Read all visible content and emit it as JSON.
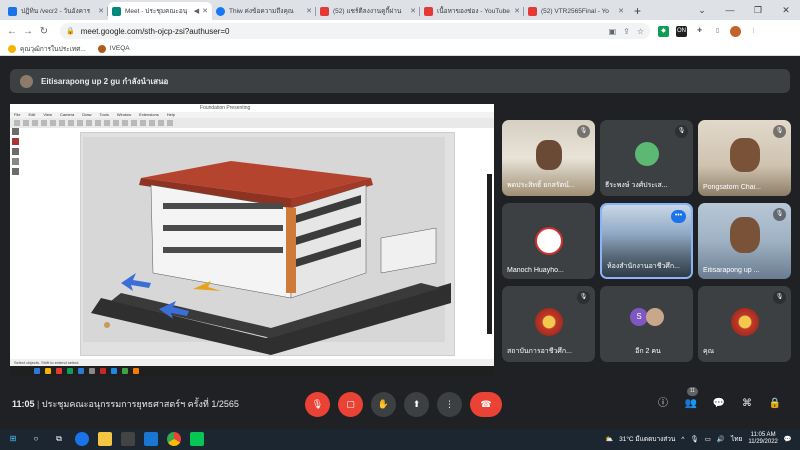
{
  "browser": {
    "tabs": [
      {
        "label": "ปฏิทิน /vecr2 - วันอังคาร",
        "color": "#1a73e8",
        "active": false
      },
      {
        "label": "Meet - ประชุมคณะอนุ",
        "color": "#00897b",
        "active": true
      },
      {
        "label": "Thiw ค่งข้อความถึงคุณ",
        "color": "#1877f2",
        "active": false
      },
      {
        "label": "(52) แชร์ตีลงงานคูกี้ผ่าน",
        "color": "#e53935",
        "active": false
      },
      {
        "label": "เนื้อหาของช่อง - YouTube",
        "color": "#e53935",
        "active": false
      },
      {
        "label": "(52) VTR2565Final - Yo",
        "color": "#e53935",
        "active": false
      }
    ],
    "new_tab": "+",
    "url": "meet.google.com/sth-ojcp-zsi?authuser=0",
    "bookmarks": [
      {
        "label": "คุณวุฒิการในประเทศ...",
        "color": "#f4b400"
      },
      {
        "label": "IVEQA",
        "color": "#b05a1e"
      }
    ]
  },
  "meet": {
    "presenter_label": "Eitisarapong up 2 gu กำลังนำเสนอ",
    "shared_screen": {
      "app_title": "Foundation    Presenting",
      "menu": [
        "File",
        "Edit",
        "View",
        "Camera",
        "Draw",
        "Tools",
        "Window",
        "Extensions",
        "Help"
      ],
      "status": "Select objects. Shift to extend select."
    },
    "participants": [
      {
        "name": "พดประสิทธิ์ ยกสรัตน์...",
        "muted": true,
        "kind": "video"
      },
      {
        "name": "ธีระพงษ์ วงศ์ประเส...",
        "muted": true,
        "kind": "avatar",
        "avatar_color": "#5bb974"
      },
      {
        "name": "Pongsatorn Chai...",
        "muted": true,
        "kind": "video"
      },
      {
        "name": "Manoch Huayho...",
        "muted": true,
        "kind": "photo"
      },
      {
        "name": "ห้องสำนักงานอาชีวศึก...",
        "muted": false,
        "kind": "video",
        "more": "•••"
      },
      {
        "name": "Eitisarapong up ...",
        "muted": true,
        "kind": "video"
      },
      {
        "name": "สถาบันการอาชีวศึก...",
        "muted": true,
        "kind": "logo"
      },
      {
        "name": "อีก 2 คน",
        "muted": false,
        "kind": "others",
        "initial": "S"
      },
      {
        "name": "คุณ",
        "muted": true,
        "kind": "logo"
      }
    ],
    "controls": {
      "time": "11:05",
      "meeting_title": "ประชุมคณะอนุกรรมการยุทธศาสตร์ฯ ครั้งที่ 1/2565",
      "people_count": "11"
    }
  },
  "taskbar": {
    "weather": "31°C  มีแดดบางส่วน",
    "lang": "ไทย",
    "time": "11:05 AM",
    "date": "11/29/2022"
  }
}
